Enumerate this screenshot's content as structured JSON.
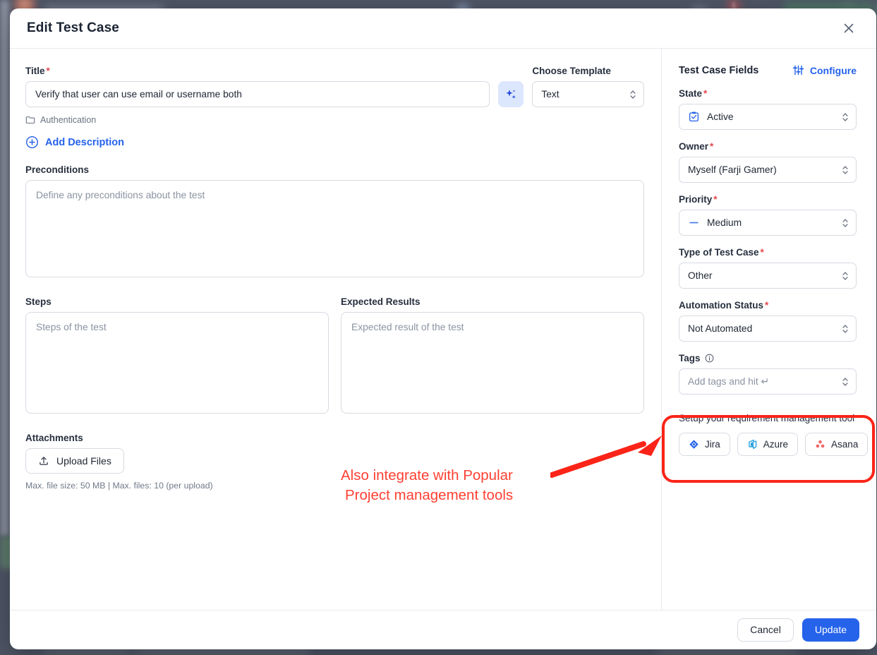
{
  "background": {
    "notification_count": "1"
  },
  "modal": {
    "title": "Edit Test Case",
    "close_icon": "close-icon"
  },
  "form": {
    "title_label": "Title",
    "title_value": "Verify that user can use email or username both",
    "ai_icon": "sparkles-icon",
    "template_label": "Choose Template",
    "template_value": "Text",
    "folder_icon": "folder-icon",
    "folder_name": "Authentication",
    "add_description_label": "Add Description",
    "add_description_icon": "plus-circle-icon",
    "preconditions_label": "Preconditions",
    "preconditions_placeholder": "Define any preconditions about the test",
    "preconditions_value": "",
    "steps_label": "Steps",
    "steps_placeholder": "Steps of the test",
    "steps_value": "",
    "expected_label": "Expected Results",
    "expected_placeholder": "Expected result of the test",
    "expected_value": "",
    "attachments_label": "Attachments",
    "upload_button_label": "Upload Files",
    "upload_icon": "upload-icon",
    "upload_hint": "Max. file size: 50 MB | Max. files: 10 (per upload)"
  },
  "fields_panel": {
    "heading": "Test Case Fields",
    "configure_label": "Configure",
    "configure_icon": "sliders-icon",
    "state": {
      "label": "State",
      "value": "Active",
      "icon": "clipboard-check-icon",
      "required": true
    },
    "owner": {
      "label": "Owner",
      "value": "Myself (Farji Gamer)",
      "required": true
    },
    "priority": {
      "label": "Priority",
      "value": "Medium",
      "icon": "dash-icon",
      "required": true
    },
    "type": {
      "label": "Type of Test Case",
      "value": "Other",
      "required": true
    },
    "automation": {
      "label": "Automation Status",
      "value": "Not Automated",
      "required": true
    },
    "tags": {
      "label": "Tags",
      "info_icon": "info-icon",
      "placeholder": "Add tags and hit ↵"
    }
  },
  "integrations": {
    "heading": "Setup your requirement management tool",
    "buttons": [
      {
        "label": "Jira",
        "icon": "jira-icon",
        "color": "#2563eb"
      },
      {
        "label": "Azure",
        "icon": "azure-devops-icon",
        "color": "#2aa3e0"
      },
      {
        "label": "Asana",
        "icon": "asana-icon",
        "color": "#f06a6a"
      }
    ]
  },
  "annotation": {
    "line1": "Also integrate with Popular",
    "line2": "Project management tools",
    "color": "#ff4033"
  },
  "footer": {
    "cancel_label": "Cancel",
    "update_label": "Update"
  },
  "colors": {
    "accent": "#2563eb",
    "required": "#e5484d",
    "annotation": "#fb2418",
    "backdrop": "#4e5565"
  }
}
